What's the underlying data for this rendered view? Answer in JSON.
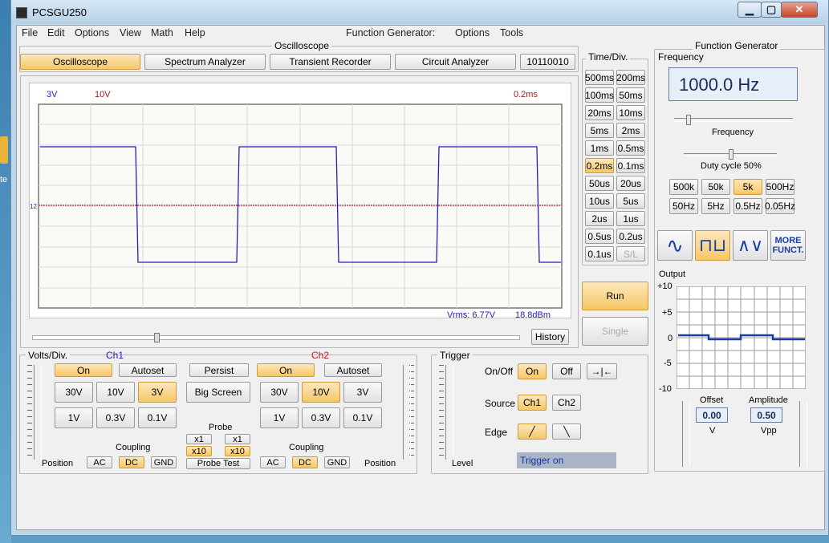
{
  "window": {
    "title": "PCSGU250"
  },
  "menu": [
    "File",
    "Edit",
    "Options",
    "View",
    "Math",
    "Help"
  ],
  "menu_fg": {
    "label": "Function Generator:",
    "items": [
      "Options",
      "Tools"
    ]
  },
  "osc": {
    "section": "Oscilloscope",
    "tabs": [
      "Oscilloscope",
      "Spectrum Analyzer",
      "Transient Recorder",
      "Circuit Analyzer",
      "10110010"
    ],
    "ch1_scale": "3V",
    "ch2_scale": "10V",
    "time_scale": "0.2ms",
    "marker": "12",
    "vrms": "Vrms: 6.77V",
    "dbm": "18.8dBm",
    "history": "History"
  },
  "timediv": {
    "label": "Time/Div.",
    "buttons": [
      "500ms",
      "200ms",
      "100ms",
      "50ms",
      "20ms",
      "10ms",
      "5ms",
      "2ms",
      "1ms",
      "0.5ms",
      "0.2ms",
      "0.1ms",
      "50us",
      "20us",
      "10us",
      "5us",
      "2us",
      "1us",
      "0.5us",
      "0.2us",
      "0.1us",
      "S/L"
    ],
    "selected": "0.2ms"
  },
  "run": "Run",
  "single": "Single",
  "volts": {
    "label": "Volts/Div.",
    "ch1": "Ch1",
    "ch2": "Ch2",
    "on": "On",
    "autoset": "Autoset",
    "persist": "Persist",
    "big_screen": "Big Screen",
    "ch1_buttons": [
      "30V",
      "10V",
      "3V",
      "1V",
      "0.3V",
      "0.1V"
    ],
    "ch1_selected": "3V",
    "ch2_buttons": [
      "30V",
      "10V",
      "3V",
      "1V",
      "0.3V",
      "0.1V"
    ],
    "ch2_selected": "10V",
    "probe": "Probe",
    "x1": "x1",
    "x10": "x10",
    "probe_test": "Probe Test",
    "coupling": "Coupling",
    "ac": "AC",
    "dc": "DC",
    "gnd": "GND",
    "position": "Position"
  },
  "trigger": {
    "label": "Trigger",
    "onoff": "On/Off",
    "on": "On",
    "off": "Off",
    "source": "Source",
    "ch1": "Ch1",
    "ch2": "Ch2",
    "edge": "Edge",
    "level": "Level",
    "status": "Trigger on"
  },
  "fg": {
    "label": "Function Generator",
    "frequency_label": "Frequency",
    "frequency_value": "1000.0 Hz",
    "freq_slider_label": "Frequency",
    "duty": "Duty cycle 50%",
    "range_buttons": [
      "500k",
      "50k",
      "5k",
      "500Hz",
      "50Hz",
      "5Hz",
      "0.5Hz",
      "0.05Hz"
    ],
    "range_selected": "5k",
    "more": "MORE FUNCT.",
    "output_label": "Output",
    "output_ticks": [
      "+10",
      "+5",
      "0",
      "-5",
      "-10"
    ],
    "offset_label": "Offset",
    "offset_value": "0.00",
    "offset_unit": "V",
    "amp_label": "Amplitude",
    "amp_value": "0.50",
    "amp_unit": "Vpp"
  },
  "colors": {
    "ch1": "#2020c0",
    "ch2": "#a02020",
    "accent": "#f6c766"
  }
}
